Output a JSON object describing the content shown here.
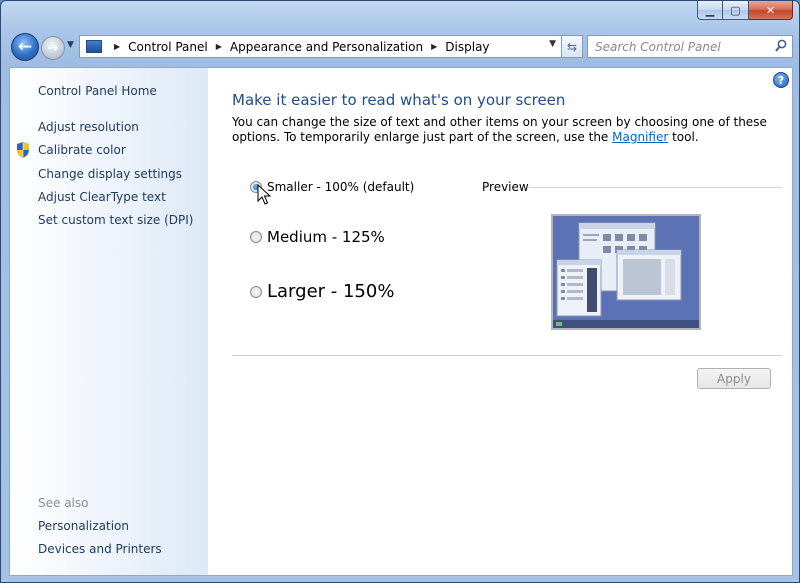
{
  "window": {
    "caption": {
      "minimize_glyph": "▁",
      "maximize_glyph": "▢",
      "close_glyph": "✕"
    }
  },
  "nav": {
    "back_glyph": "←",
    "forward_glyph": "→",
    "breadcrumb": [
      "Control Panel",
      "Appearance and Personalization",
      "Display"
    ],
    "search_placeholder": "Search Control Panel",
    "icons": {
      "back": "back-arrow-icon",
      "forward": "forward-arrow-icon",
      "refresh": "refresh-icon",
      "search": "magnifier-search-icon",
      "address": "control-panel-icon"
    }
  },
  "sidebar": {
    "home": "Control Panel Home",
    "links": [
      "Adjust resolution",
      "Calibrate color",
      "Change display settings",
      "Adjust ClearType text",
      "Set custom text size (DPI)"
    ],
    "see_also_label": "See also",
    "see_also_links": [
      "Personalization",
      "Devices and Printers"
    ]
  },
  "main": {
    "help_glyph": "?",
    "title": "Make it easier to read what's on your screen",
    "description_part1": "You can change the size of text and other items on your screen by choosing one of these options. To temporarily enlarge just part of the screen, use the ",
    "magnifier_link": "Magnifier",
    "description_part2": " tool.",
    "options": [
      {
        "label": "Smaller - 100% (default)",
        "checked": true
      },
      {
        "label": "Medium - 125%",
        "checked": false
      },
      {
        "label": "Larger - 150%",
        "checked": false
      }
    ],
    "preview_label": "Preview",
    "apply_label": "Apply"
  },
  "colors": {
    "title_blue": "#1e4c8c",
    "link_blue": "#0066cc",
    "sidebar_text": "#1e395b"
  }
}
